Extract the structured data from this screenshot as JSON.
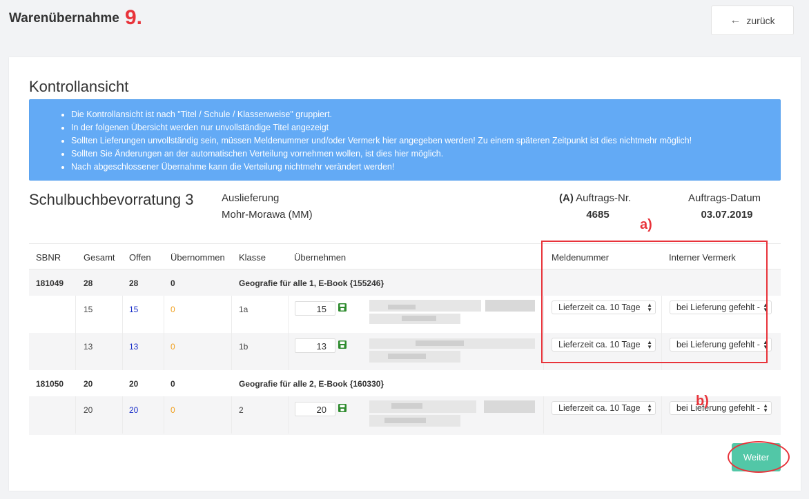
{
  "header": {
    "title": "Warenübernahme",
    "step_annotation": "9.",
    "back_label": "zurück"
  },
  "control": {
    "title": "Kontrollansicht",
    "info": [
      "Die Kontrollansicht ist nach \"Titel / Schule / Klassenweise\" gruppiert.",
      "In der folgenen Übersicht werden nur unvollständige Titel angezeigt",
      "Sollten Lieferungen unvollständig sein, müssen Meldenummer und/oder Vermerk hier angegeben werden! Zu einem späteren Zeitpunkt ist dies nichtmehr möglich!",
      "Sollten Sie Änderungen an der automatischen Verteilung vornehmen wollen, ist dies hier möglich.",
      "Nach abgeschlossener Übernahme kann die Verteilung nichtmehr verändert werden!"
    ]
  },
  "order": {
    "name": "Schulbuchbevorratung 3",
    "delivery_label": "Auslieferung",
    "delivery_value": "Mohr-Morawa (MM)",
    "order_no_prefix": "(A)",
    "order_no_label": "Auftrags-Nr.",
    "order_no": "4685",
    "order_date_label": "Auftrags-Datum",
    "order_date": "03.07.2019"
  },
  "table": {
    "headers": {
      "sbnr": "SBNR",
      "gesamt": "Gesamt",
      "offen": "Offen",
      "uebernommen": "Übernommen",
      "klasse": "Klasse",
      "uebernehmen": "Übernehmen",
      "meldenummer": "Meldenummer",
      "vermerk": "Interner Vermerk"
    },
    "groups": [
      {
        "sbnr": "181049",
        "gesamt": "28",
        "offen": "28",
        "uebernommen": "0",
        "title": "Geografie für alle 1, E-Book {155246}",
        "rows": [
          {
            "gesamt": "15",
            "offen": "15",
            "uebernommen": "0",
            "klasse": "1a",
            "qty": "15",
            "meldenummer": "Lieferzeit ca. 10 Tage",
            "vermerk": "bei Lieferung gefehlt -"
          },
          {
            "gesamt": "13",
            "offen": "13",
            "uebernommen": "0",
            "klasse": "1b",
            "qty": "13",
            "meldenummer": "Lieferzeit ca. 10 Tage",
            "vermerk": "bei Lieferung gefehlt -"
          }
        ]
      },
      {
        "sbnr": "181050",
        "gesamt": "20",
        "offen": "20",
        "uebernommen": "0",
        "title": "Geografie für alle 2, E-Book {160330}",
        "rows": [
          {
            "gesamt": "20",
            "offen": "20",
            "uebernommen": "0",
            "klasse": "2",
            "qty": "20",
            "meldenummer": "Lieferzeit ca. 10 Tage",
            "vermerk": "bei Lieferung gefehlt -"
          }
        ]
      }
    ]
  },
  "annotations": {
    "a": "a)",
    "b": "b)"
  },
  "actions": {
    "next_label": "Weiter"
  },
  "colors": {
    "info_bg": "#63aaf5",
    "accent_red": "#e8333a",
    "next_button": "#52c7a7",
    "offen_blue": "#1a2fc9",
    "uebernommen_orange": "#f0a020",
    "save_green": "#2e8b2e"
  }
}
